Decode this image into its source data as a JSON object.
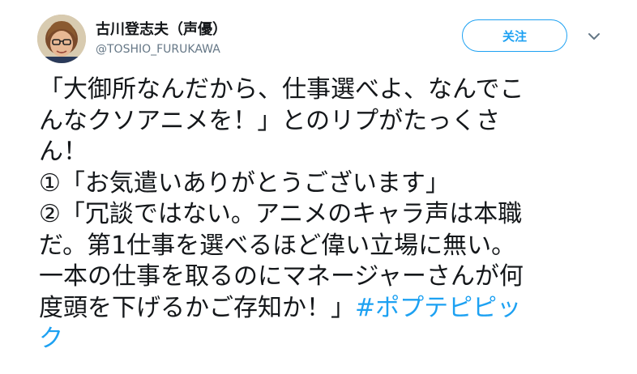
{
  "tweet": {
    "display_name": "古川登志夫（声優）",
    "handle": "@TOSHIO_FURUKAWA",
    "follow_label": "关注",
    "body_lines": [
      "「大御所なんだから、仕事選べよ、なんでこ",
      "んなクソアニメを！」とのリプがたっくさ",
      "ん！",
      "①「お気遣いありがとうございます」",
      "②「冗談ではない。アニメのキャラ声は本職",
      "だ。第1仕事を選べるほど偉い立場に無い。",
      "一本の仕事を取るのにマネージャーさんが何"
    ],
    "last_line_text": "度頭を下げるかご存知か！」",
    "hashtag_part1": "#ポプテピピッ",
    "hashtag_part2": "ク"
  },
  "icons": {
    "menu": "chevron-down-icon",
    "avatar": "profile-photo"
  },
  "colors": {
    "accent": "#1da1f2",
    "text": "#14171a",
    "secondary": "#657786"
  }
}
